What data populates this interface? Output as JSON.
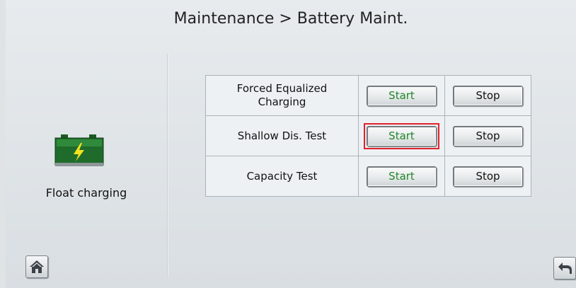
{
  "header": {
    "title": "Maintenance > Battery Maint."
  },
  "status": {
    "label": "Float charging",
    "icon": "battery-charging-icon"
  },
  "operations": [
    {
      "label": "Forced Equalized Charging",
      "start_label": "Start",
      "stop_label": "Stop"
    },
    {
      "label": "Shallow Dis. Test",
      "start_label": "Start",
      "stop_label": "Stop"
    },
    {
      "label": "Capacity Test",
      "start_label": "Start",
      "stop_label": "Stop"
    }
  ],
  "nav": {
    "home_icon": "home-icon",
    "back_icon": "back-arrow-icon"
  },
  "colors": {
    "start_text": "#20862a",
    "highlight": "#e0232b",
    "battery": "#1f6b2b"
  }
}
